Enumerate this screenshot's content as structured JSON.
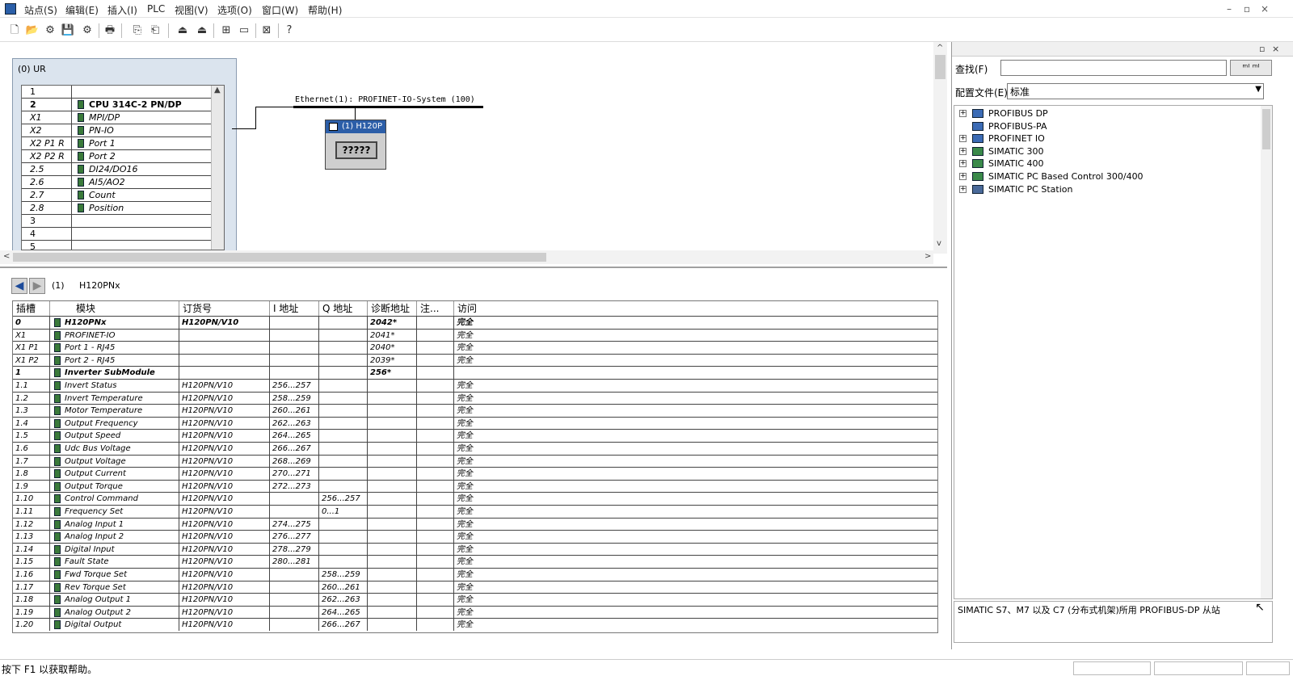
{
  "menu": [
    "站点(S)",
    "编辑(E)",
    "插入(I)",
    "PLC",
    "视图(V)",
    "选项(O)",
    "窗口(W)",
    "帮助(H)"
  ],
  "window_buttons": [
    "–",
    "▫",
    "×"
  ],
  "toolbar": [
    "🗋",
    "📂",
    "⚙",
    "💾",
    "⚙",
    "🖶",
    "⎘",
    "⎗",
    "⏏",
    "⏏",
    "⊞",
    "▭",
    "⊠",
    "?"
  ],
  "rack": {
    "title": "(0) UR",
    "rows": [
      {
        "slot": "1",
        "module": ""
      },
      {
        "slot": "2",
        "module": "CPU 314C-2 PN/DP"
      },
      {
        "slot": "X1",
        "module": "MPI/DP"
      },
      {
        "slot": "X2",
        "module": "PN-IO"
      },
      {
        "slot": "X2 P1 R",
        "module": "Port 1"
      },
      {
        "slot": "X2 P2 R",
        "module": "Port 2"
      },
      {
        "slot": "2.5",
        "module": "DI24/DO16"
      },
      {
        "slot": "2.6",
        "module": "AI5/AO2"
      },
      {
        "slot": "2.7",
        "module": "Count"
      },
      {
        "slot": "2.8",
        "module": "Position"
      },
      {
        "slot": "3",
        "module": ""
      },
      {
        "slot": "4",
        "module": ""
      },
      {
        "slot": "5",
        "module": ""
      }
    ]
  },
  "network": {
    "label": "Ethernet(1): PROFINET-IO-System (100)"
  },
  "device": {
    "title": "(1) H120P",
    "body": "?????"
  },
  "detail": {
    "slot_label": "(1)",
    "name": "H120PNx",
    "headers": {
      "slot": "插槽",
      "module": "模块",
      "order": "订货号",
      "iaddr": "I 地址",
      "qaddr": "Q 地址",
      "diag": "诊断地址",
      "comment": "注...",
      "access": "访问"
    },
    "rows": [
      {
        "slot": "0",
        "module": "H120PNx",
        "order": "H120PN/V10",
        "i": "",
        "q": "",
        "diag": "2042*",
        "access": "完全",
        "bold": true
      },
      {
        "slot": "X1",
        "module": "PROFINET-IO",
        "order": "",
        "i": "",
        "q": "",
        "diag": "2041*",
        "access": "完全",
        "bold": false
      },
      {
        "slot": "X1 P1",
        "module": "Port 1 - RJ45",
        "order": "",
        "i": "",
        "q": "",
        "diag": "2040*",
        "access": "完全",
        "bold": false
      },
      {
        "slot": "X1 P2",
        "module": "Port 2 - RJ45",
        "order": "",
        "i": "",
        "q": "",
        "diag": "2039*",
        "access": "完全",
        "bold": false
      },
      {
        "slot": "1",
        "module": "Inverter SubModule",
        "order": "",
        "i": "",
        "q": "",
        "diag": "256*",
        "access": "",
        "bold": true
      },
      {
        "slot": "1.1",
        "module": "Invert Status",
        "order": "H120PN/V10",
        "i": "256...257",
        "q": "",
        "diag": "",
        "access": "完全",
        "bold": false
      },
      {
        "slot": "1.2",
        "module": "Invert Temperature",
        "order": "H120PN/V10",
        "i": "258...259",
        "q": "",
        "diag": "",
        "access": "完全",
        "bold": false
      },
      {
        "slot": "1.3",
        "module": "Motor Temperature",
        "order": "H120PN/V10",
        "i": "260...261",
        "q": "",
        "diag": "",
        "access": "完全",
        "bold": false
      },
      {
        "slot": "1.4",
        "module": "Output Frequency",
        "order": "H120PN/V10",
        "i": "262...263",
        "q": "",
        "diag": "",
        "access": "完全",
        "bold": false
      },
      {
        "slot": "1.5",
        "module": "Output Speed",
        "order": "H120PN/V10",
        "i": "264...265",
        "q": "",
        "diag": "",
        "access": "完全",
        "bold": false
      },
      {
        "slot": "1.6",
        "module": "Udc Bus Voltage",
        "order": "H120PN/V10",
        "i": "266...267",
        "q": "",
        "diag": "",
        "access": "完全",
        "bold": false
      },
      {
        "slot": "1.7",
        "module": "Output Voltage",
        "order": "H120PN/V10",
        "i": "268...269",
        "q": "",
        "diag": "",
        "access": "完全",
        "bold": false
      },
      {
        "slot": "1.8",
        "module": "Output Current",
        "order": "H120PN/V10",
        "i": "270...271",
        "q": "",
        "diag": "",
        "access": "完全",
        "bold": false
      },
      {
        "slot": "1.9",
        "module": "Output Torque",
        "order": "H120PN/V10",
        "i": "272...273",
        "q": "",
        "diag": "",
        "access": "完全",
        "bold": false
      },
      {
        "slot": "1.10",
        "module": "Control Command",
        "order": "H120PN/V10",
        "i": "",
        "q": "256...257",
        "diag": "",
        "access": "完全",
        "bold": false
      },
      {
        "slot": "1.11",
        "module": "Frequency Set",
        "order": "H120PN/V10",
        "i": "",
        "q": "0...1",
        "diag": "",
        "access": "完全",
        "bold": false
      },
      {
        "slot": "1.12",
        "module": "Analog Input 1",
        "order": "H120PN/V10",
        "i": "274...275",
        "q": "",
        "diag": "",
        "access": "完全",
        "bold": false
      },
      {
        "slot": "1.13",
        "module": "Analog Input 2",
        "order": "H120PN/V10",
        "i": "276...277",
        "q": "",
        "diag": "",
        "access": "完全",
        "bold": false
      },
      {
        "slot": "1.14",
        "module": "Digital Input",
        "order": "H120PN/V10",
        "i": "278...279",
        "q": "",
        "diag": "",
        "access": "完全",
        "bold": false
      },
      {
        "slot": "1.15",
        "module": "Fault State",
        "order": "H120PN/V10",
        "i": "280...281",
        "q": "",
        "diag": "",
        "access": "完全",
        "bold": false
      },
      {
        "slot": "1.16",
        "module": "Fwd Torque Set",
        "order": "H120PN/V10",
        "i": "",
        "q": "258...259",
        "diag": "",
        "access": "完全",
        "bold": false
      },
      {
        "slot": "1.17",
        "module": "Rev Torque Set",
        "order": "H120PN/V10",
        "i": "",
        "q": "260...261",
        "diag": "",
        "access": "完全",
        "bold": false
      },
      {
        "slot": "1.18",
        "module": "Analog Output 1",
        "order": "H120PN/V10",
        "i": "",
        "q": "262...263",
        "diag": "",
        "access": "完全",
        "bold": false
      },
      {
        "slot": "1.19",
        "module": "Analog Output 2",
        "order": "H120PN/V10",
        "i": "",
        "q": "264...265",
        "diag": "",
        "access": "完全",
        "bold": false
      },
      {
        "slot": "1.20",
        "module": "Digital Output",
        "order": "H120PN/V10",
        "i": "",
        "q": "266...267",
        "diag": "",
        "access": "完全",
        "bold": false
      }
    ]
  },
  "catalog": {
    "find_label": "查找(F)",
    "find_value": "",
    "find_buttons": "ᵐᴵ ᵐᴵ",
    "profile_label": "配置文件(E)",
    "profile_value": "标准",
    "tree": [
      {
        "label": "PROFIBUS DP",
        "expand": "+",
        "color": "#3b6bb5"
      },
      {
        "label": "PROFIBUS-PA",
        "expand": "",
        "color": "#3b6bb5"
      },
      {
        "label": "PROFINET IO",
        "expand": "+",
        "color": "#3b6bb5"
      },
      {
        "label": "SIMATIC 300",
        "expand": "+",
        "color": "#3a8a4a"
      },
      {
        "label": "SIMATIC 400",
        "expand": "+",
        "color": "#3a8a4a"
      },
      {
        "label": "SIMATIC PC Based Control 300/400",
        "expand": "+",
        "color": "#3a8a4a"
      },
      {
        "label": "SIMATIC PC Station",
        "expand": "+",
        "color": "#4a6a9a"
      }
    ],
    "description": "SIMATIC S7、M7 以及 C7 (分布式机架)所用 PROFIBUS-DP 从站"
  },
  "status": {
    "text": "按下 F1 以获取帮助。"
  }
}
